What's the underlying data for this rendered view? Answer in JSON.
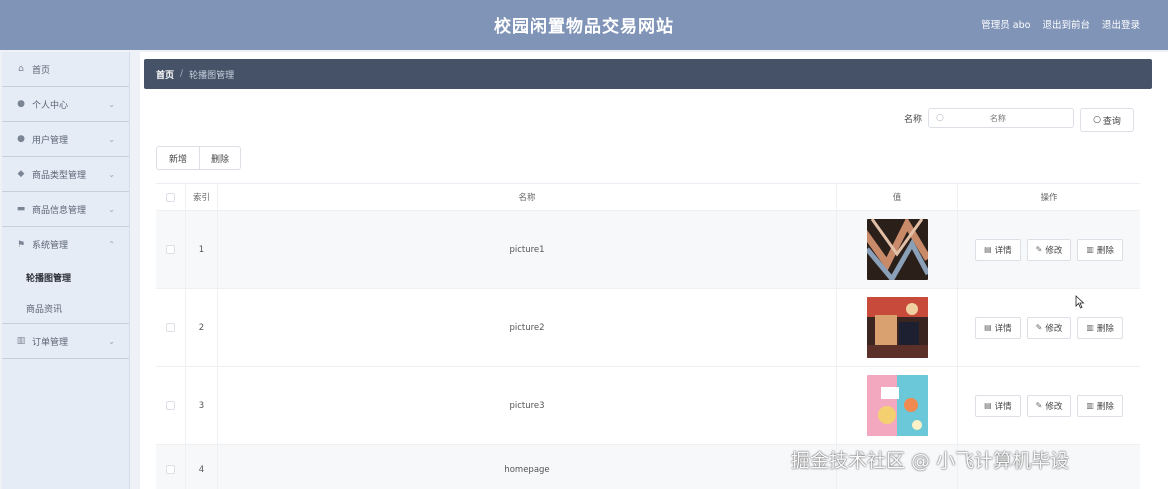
{
  "header": {
    "title": "校园闲置物品交易网站",
    "admin_label": "管理员 abo",
    "backend_link": "退出到前台",
    "logout_link": "退出登录"
  },
  "sidebar": {
    "items": [
      {
        "label": "首页",
        "icon": "home-icon"
      },
      {
        "label": "个人中心",
        "icon": "user-icon"
      },
      {
        "label": "用户管理",
        "icon": "users-icon"
      },
      {
        "label": "商品类型管理",
        "icon": "location-icon"
      },
      {
        "label": "商品信息管理",
        "icon": "product-icon"
      },
      {
        "label": "系统管理",
        "icon": "flag-icon"
      },
      {
        "label": "订单管理",
        "icon": "chart-icon"
      }
    ],
    "sub_items": [
      {
        "label": "轮播图管理",
        "active": true
      },
      {
        "label": "商品资讯",
        "active": false
      }
    ]
  },
  "breadcrumb": {
    "home": "首页",
    "separator": "/",
    "current": "轮播图管理"
  },
  "search": {
    "label": "名称",
    "placeholder": "名称",
    "button_label": "查询"
  },
  "toolbar": {
    "add_label": "新增",
    "delete_label": "删除"
  },
  "table": {
    "columns": [
      "索引",
      "名称",
      "值",
      "操作"
    ],
    "rows": [
      {
        "index": "1",
        "name": "picture1",
        "thumb_colors": [
          "#3a2a22",
          "#c98a6a",
          "#8aa0b8"
        ]
      },
      {
        "index": "2",
        "name": "picture2",
        "thumb_colors": [
          "#4a2a22",
          "#c84a3a",
          "#d9a070"
        ]
      },
      {
        "index": "3",
        "name": "picture3",
        "thumb_colors": [
          "#f0a0b8",
          "#6ac8d8",
          "#f4d070"
        ]
      },
      {
        "index": "4",
        "name": "homepage",
        "thumb_colors": []
      }
    ],
    "op_labels": {
      "detail": "详情",
      "edit": "修改",
      "delete": "删除"
    }
  },
  "watermark": "掘金技术社区 @ 小飞计算机毕设"
}
